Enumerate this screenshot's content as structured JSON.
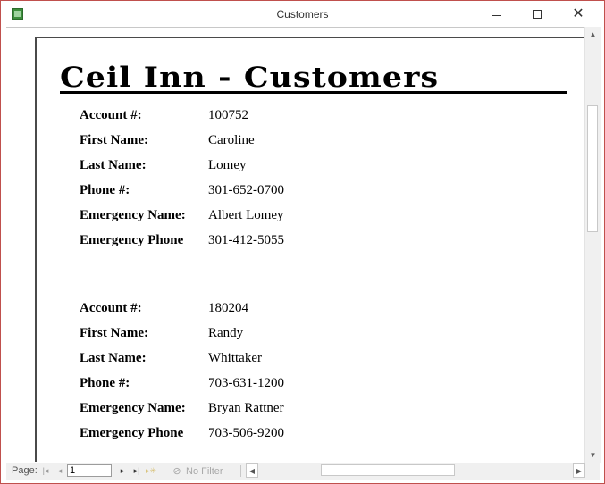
{
  "window": {
    "title": "Customers",
    "icon": "access-report-icon"
  },
  "report": {
    "title": "Ceil Inn - Customers",
    "labels": {
      "account": "Account #:",
      "first_name": "First Name:",
      "last_name": "Last Name:",
      "phone": "Phone #:",
      "emergency_name": "Emergency Name:",
      "emergency_phone": "Emergency Phone"
    },
    "records": [
      {
        "account": "100752",
        "first_name": "Caroline",
        "last_name": "Lomey",
        "phone": "301-652-0700",
        "emergency_name": "Albert Lomey",
        "emergency_phone": "301-412-5055"
      },
      {
        "account": "180204",
        "first_name": "Randy",
        "last_name": "Whittaker",
        "phone": "703-631-1200",
        "emergency_name": "Bryan Rattner",
        "emergency_phone": "703-506-9200"
      }
    ]
  },
  "navigation": {
    "page_label": "Page:",
    "page_value": "1",
    "filter_label": "No Filter"
  },
  "icons": {
    "first": "|◂",
    "prev": "◂",
    "next": "▸",
    "last": "▸|",
    "new": "▸✳",
    "filter": "⊘",
    "scroll_up": "▲",
    "scroll_down": "▼",
    "scroll_left": "◀",
    "scroll_right": "▶"
  }
}
